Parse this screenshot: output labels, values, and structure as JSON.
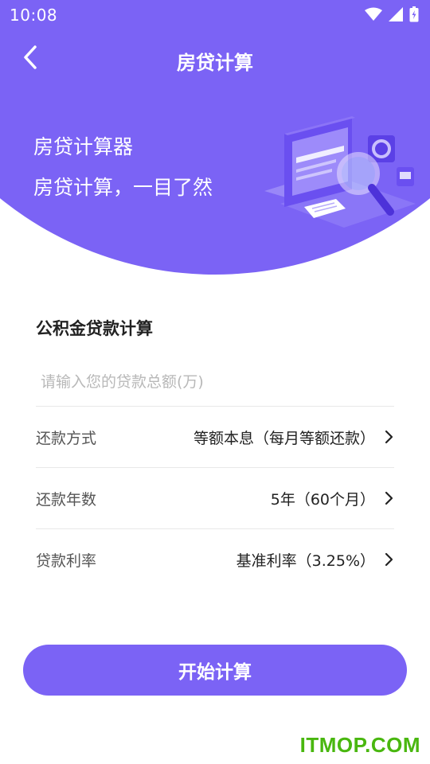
{
  "colors": {
    "primary": "#7b63f5",
    "text": "#222222",
    "label": "#555555",
    "placeholder": "#b8b8b8",
    "divider": "#e8e8e8",
    "watermark": "#49b70f"
  },
  "status_bar": {
    "time": "10:08",
    "icons": [
      "wifi-icon",
      "cell-signal-icon",
      "battery-icon"
    ]
  },
  "nav": {
    "back_icon": "chevron-left-icon",
    "title": "房贷计算"
  },
  "hero": {
    "title": "房贷计算器",
    "subtitle": "房贷计算，一目了然",
    "illustration": "magnifier-documents-illustration"
  },
  "form": {
    "section_title": "公积金贷款计算",
    "amount": {
      "value": "",
      "placeholder": "请输入您的贷款总额(万)"
    },
    "rows": [
      {
        "label": "还款方式",
        "value": "等额本息（每月等额还款）"
      },
      {
        "label": "还款年数",
        "value": "5年（60个月）"
      },
      {
        "label": "贷款利率",
        "value": "基准利率（3.25%）"
      }
    ]
  },
  "start_button": {
    "label": "开始计算"
  },
  "watermark": {
    "text": "ITMOP.COM"
  }
}
